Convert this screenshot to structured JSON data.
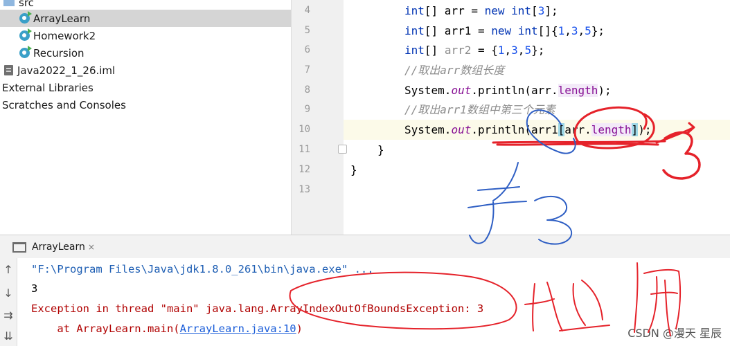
{
  "project_tree": {
    "items": [
      {
        "label": "src",
        "icon": "folder-icon"
      },
      {
        "label": "ArrayLearn",
        "icon": "java-class-icon",
        "selected": true
      },
      {
        "label": "Homework2",
        "icon": "java-class-icon"
      },
      {
        "label": "Recursion",
        "icon": "java-class-icon"
      },
      {
        "label": "Java2022_1_26.iml",
        "icon": "iml-file-icon"
      },
      {
        "label": "External Libraries",
        "icon": ""
      },
      {
        "label": "Scratches and Consoles",
        "icon": ""
      }
    ]
  },
  "editor": {
    "line_numbers": [
      "4",
      "5",
      "6",
      "7",
      "8",
      "9",
      "10",
      "11",
      "12",
      "13"
    ],
    "current_line": "10",
    "lines": {
      "l4": {
        "t1": "int",
        "t2": "[] arr = ",
        "t3": "new int",
        "t4": "[",
        "t5": "3",
        "t6": "];"
      },
      "l5": {
        "t1": "int",
        "t2": "[] arr1 = ",
        "t3": "new int",
        "t4": "[]{",
        "t5": "1",
        "t6": ",",
        "t7": "3",
        "t8": ",",
        "t9": "5",
        "t10": "};"
      },
      "l6": {
        "t1": "int",
        "t2": "[] ",
        "t3": "arr2",
        "t4": " = {",
        "t5": "1",
        "t6": ",",
        "t7": "3",
        "t8": ",",
        "t9": "5",
        "t10": "};"
      },
      "l7": {
        "t1": "//取出arr数组长度"
      },
      "l8": {
        "t1": "System.",
        "t2": "out",
        "t3": ".println(arr.",
        "t4": "length",
        "t5": ");"
      },
      "l9": {
        "t1": "//取出arr1数组中第三个元素"
      },
      "l10": {
        "t1": "System.",
        "t2": "out",
        "t3": ".println(arr1",
        "t4": "[",
        "t5": "arr.",
        "t6": "length",
        "t7": "]",
        "t8": ");"
      },
      "l11": {
        "t1": "}"
      },
      "l12": {
        "t1": "}"
      }
    }
  },
  "run_panel": {
    "tab_label": "ArrayLearn",
    "tab_close": "×",
    "side_buttons": [
      "↑",
      "↓",
      "⇉",
      "⇊"
    ],
    "console": {
      "cmd": "\"F:\\Program Files\\Java\\jdk1.8.0_261\\bin\\java.exe\" ...",
      "out": "3",
      "err": "Exception in thread \"main\" java.lang.ArrayIndexOutOfBoundsException: 3",
      "trace_prefix": "    at ArrayLearn.main(",
      "trace_link": "ArrayLearn.java:10",
      "trace_suffix": ")"
    }
  },
  "watermark": "CSDN @漫天 星辰",
  "colors": {
    "keyword": "#0033b3",
    "number": "#1750eb",
    "comment": "#8c8c8c",
    "static_field": "#871094",
    "error_text": "#b00000",
    "link": "#1a5dd9",
    "selection": "#d5d5d5",
    "caret_line": "#fcfae9",
    "red_ink": "#e5222a",
    "blue_ink": "#2f5fc4"
  }
}
